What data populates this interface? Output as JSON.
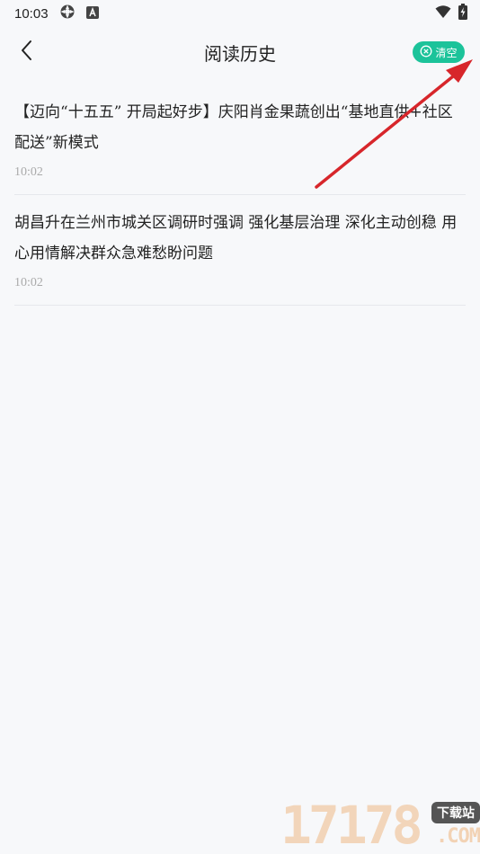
{
  "status_bar": {
    "time": "10:03",
    "icons": [
      "settings-app-icon",
      "a-badge-icon",
      "wifi-icon",
      "battery-charging-icon"
    ]
  },
  "nav": {
    "title": "阅读历史",
    "back_icon": "chevron-left-icon",
    "clear_label": "清空",
    "clear_icon": "circle-x-icon",
    "clear_color": "#1cc39a"
  },
  "history": [
    {
      "title": "【迈向“十五五” 开局起好步】庆阳肖金果蔬创出“基地直供+社区配送”新模式",
      "time": "10:02"
    },
    {
      "title": "胡昌升在兰州市城关区调研时强调 强化基层治理 深化主动创稳 用心用情解决群众急难愁盼问题",
      "time": "10:02"
    }
  ],
  "annotation": {
    "arrow_color": "#d7262b"
  },
  "watermark": {
    "number": "17178",
    "badge": "下载站",
    "suffix": ".COM"
  }
}
